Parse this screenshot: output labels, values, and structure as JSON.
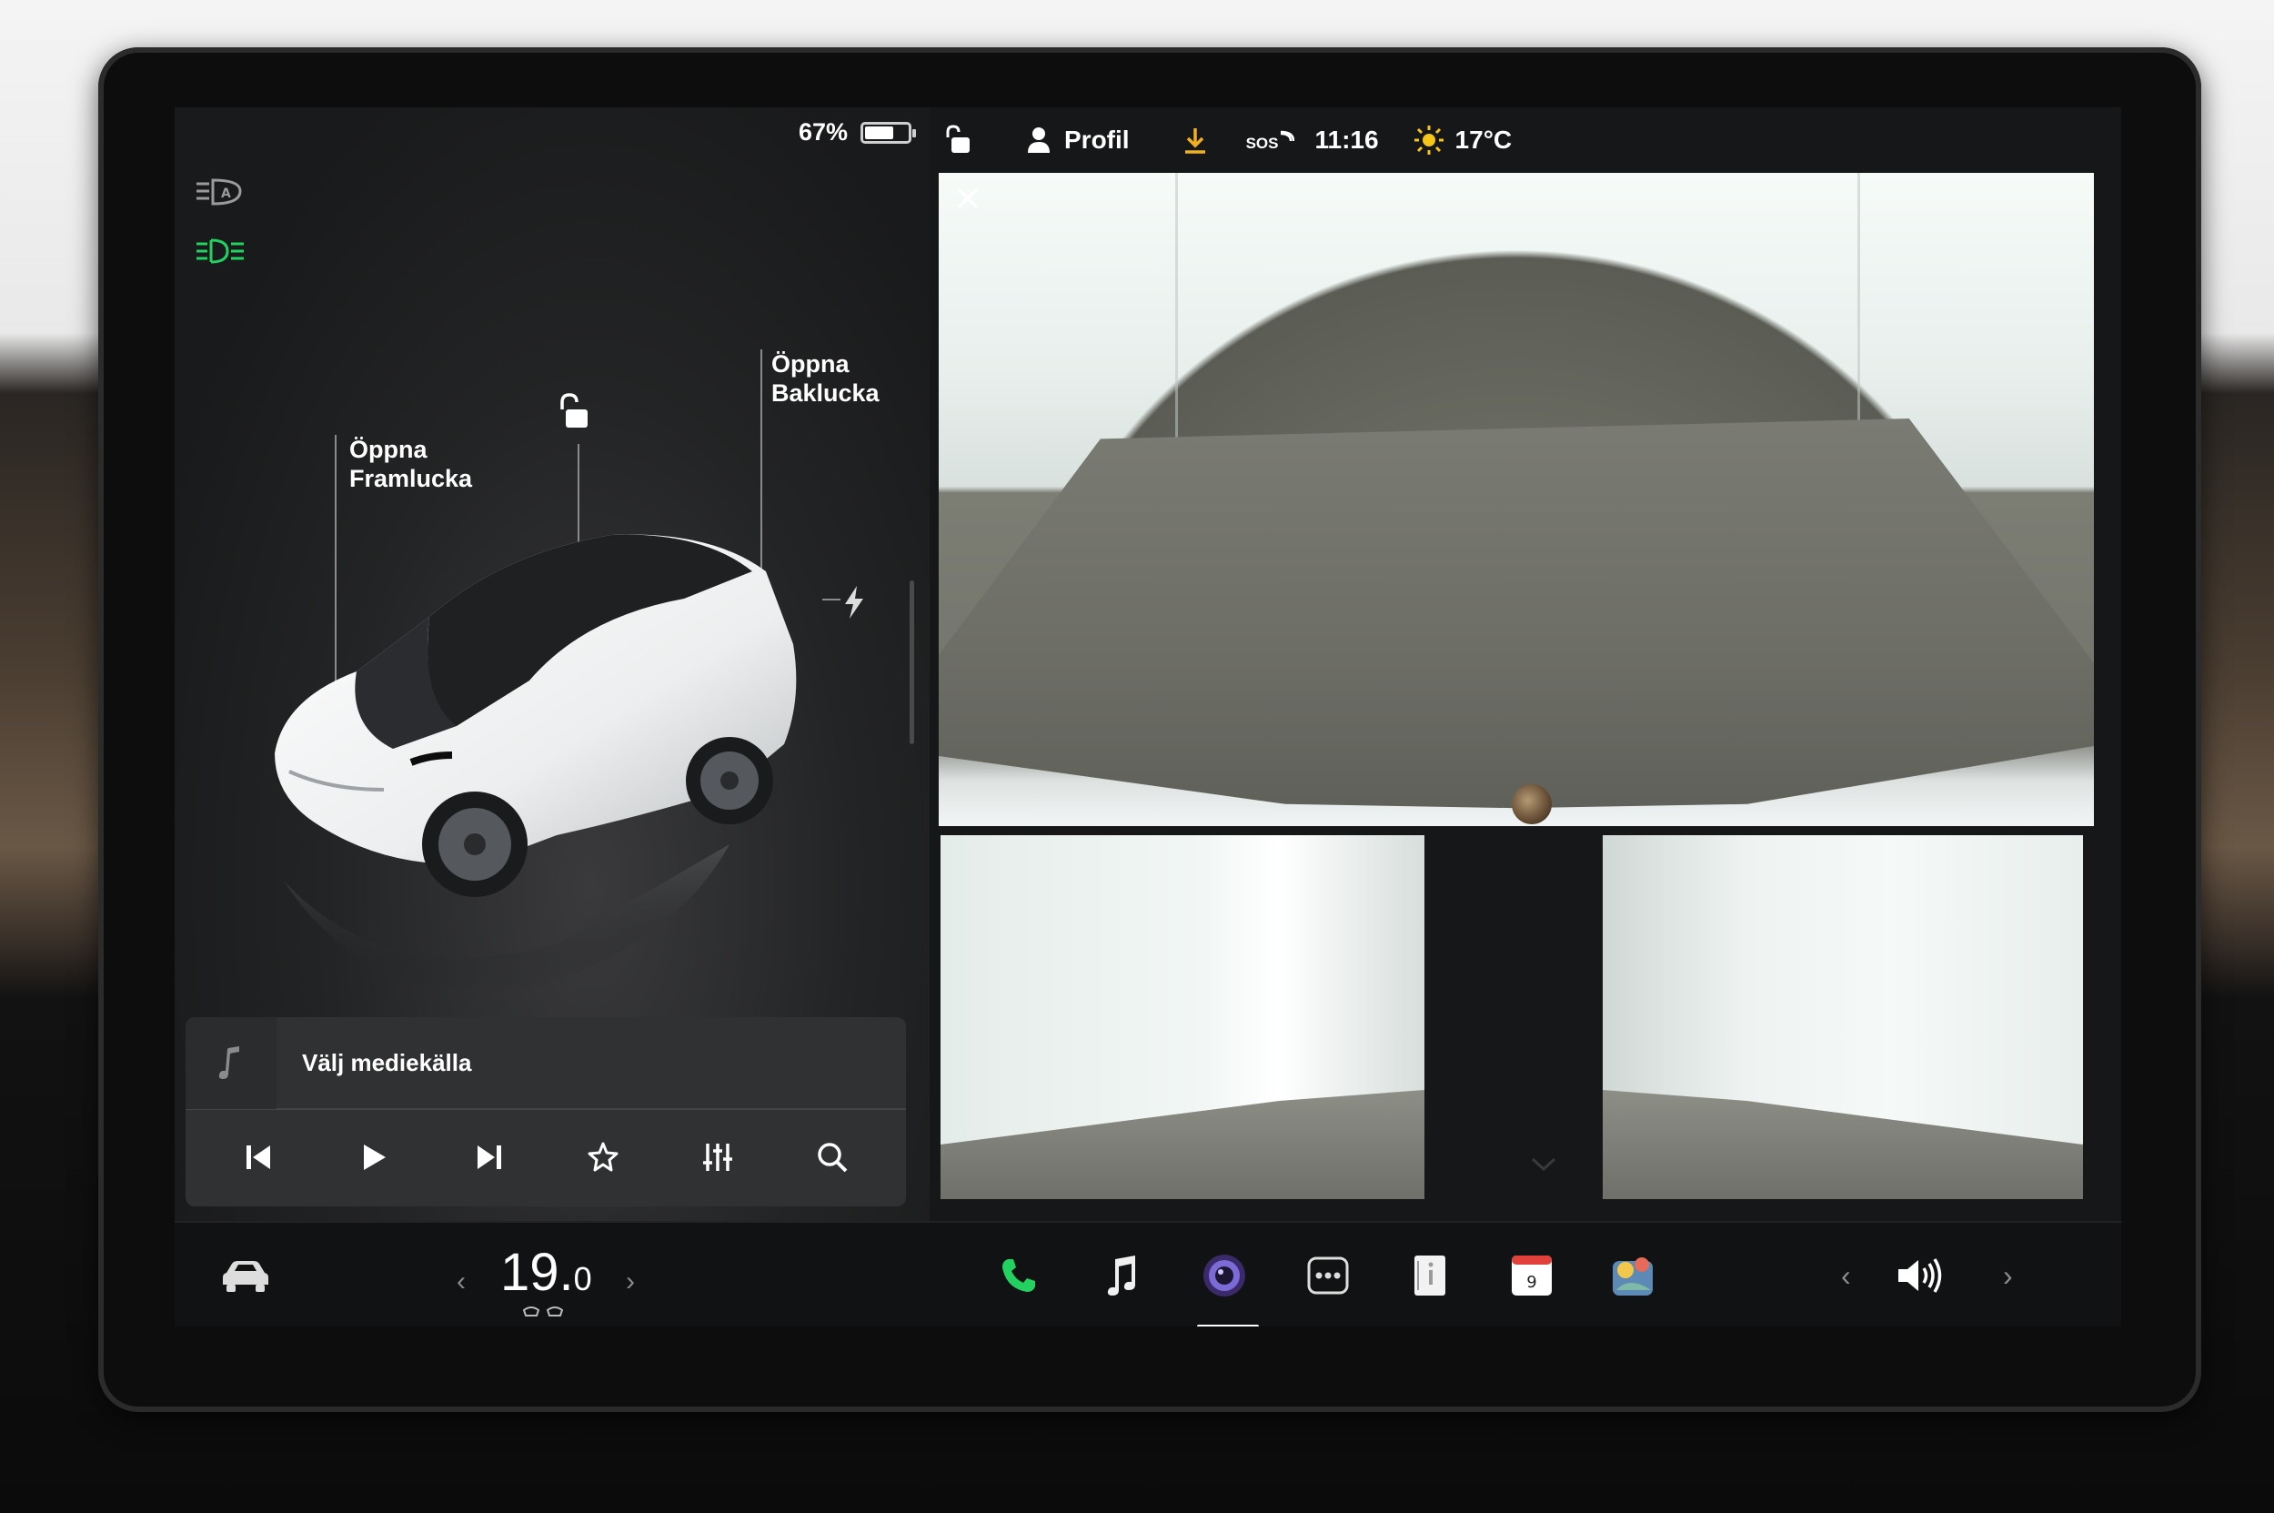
{
  "status": {
    "battery_percent": "67%",
    "battery_level": 0.67,
    "profile_label": "Profil",
    "time": "11:16",
    "temperature_outside": "17°C",
    "sos_label": "SOS"
  },
  "car_view": {
    "frunk_label": "Öppna\nFramlucka",
    "trunk_label": "Öppna\nBaklucka"
  },
  "media": {
    "source_label": "Välj mediekälla"
  },
  "climate": {
    "temp_integer": "19.",
    "temp_decimal": "0"
  },
  "dock": {
    "calendar_day": "9"
  },
  "icons": [
    "headlights-auto-icon",
    "low-beam-icon",
    "lock-open-icon",
    "charge-bolt-icon",
    "music-note-icon",
    "skip-back-icon",
    "play-icon",
    "skip-forward-icon",
    "favorite-star-icon",
    "equalizer-icon",
    "search-icon",
    "profile-person-icon",
    "download-icon",
    "sos-icon",
    "sun-icon",
    "close-icon",
    "car-icon",
    "phone-icon",
    "music-app-icon",
    "camera-app-icon",
    "more-apps-icon",
    "manual-book-icon",
    "calendar-icon",
    "toybox-icon",
    "volume-icon"
  ],
  "colors": {
    "accent_green": "#23d160",
    "download_amber": "#f2b01e",
    "sun_yellow": "#f5c518",
    "calendar_red": "#e0413b"
  }
}
